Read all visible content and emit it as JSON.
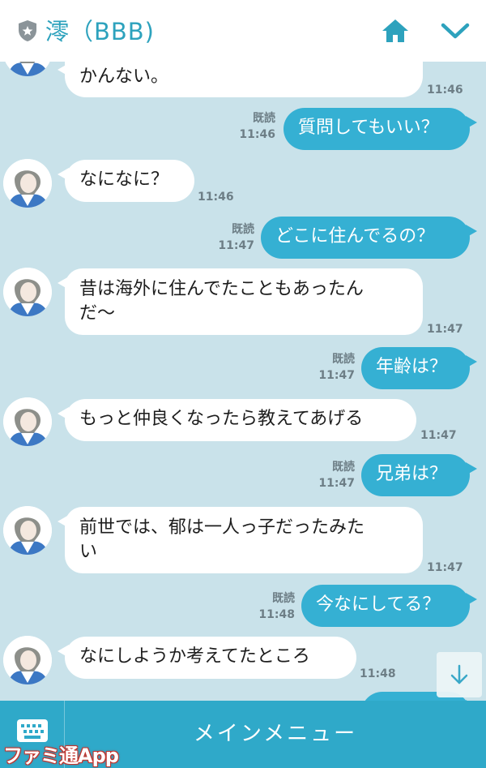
{
  "header": {
    "title": "澪（BBB)",
    "shield_icon": "star-shield-icon",
    "home_icon": "home-icon",
    "chevron_icon": "chevron-down-icon",
    "accent": "#2da2bd"
  },
  "messages": [
    {
      "dir": "in",
      "text": "かんない。",
      "time": "11:46"
    },
    {
      "dir": "out",
      "text": "質問してもいい？",
      "read": "既読",
      "time": "11:46"
    },
    {
      "dir": "in",
      "text": "なになに？",
      "time": "11:46"
    },
    {
      "dir": "out",
      "text": "どこに住んでるの？",
      "read": "既読",
      "time": "11:47"
    },
    {
      "dir": "in",
      "line1": "昔は海外に住んでたこともあったん",
      "line2": "だ〜",
      "time": "11:47"
    },
    {
      "dir": "out",
      "text": "年齢は？",
      "read": "既読",
      "time": "11:47"
    },
    {
      "dir": "in",
      "text": "もっと仲良くなったら教えてあげる",
      "time": "11:47"
    },
    {
      "dir": "out",
      "text": "兄弟は？",
      "read": "既読",
      "time": "11:47"
    },
    {
      "dir": "in",
      "line1": "前世では、郁は一人っ子だったみた",
      "line2": "い",
      "time": "11:47"
    },
    {
      "dir": "out",
      "text": "今なにしてる？",
      "read": "既読",
      "time": "11:48"
    },
    {
      "dir": "in",
      "text": "なにしようか考えてたところ",
      "time": "11:48"
    }
  ],
  "scroll_icon": "arrow-down-icon",
  "footer": {
    "keyboard_icon": "keyboard-icon",
    "main_menu": "メインメニュー"
  },
  "watermark": "ファミ通App",
  "colors": {
    "background": "#c9e2ea",
    "outgoing_bubble": "#35b0d3",
    "incoming_bubble": "#ffffff",
    "footer": "#2fa9c9"
  }
}
